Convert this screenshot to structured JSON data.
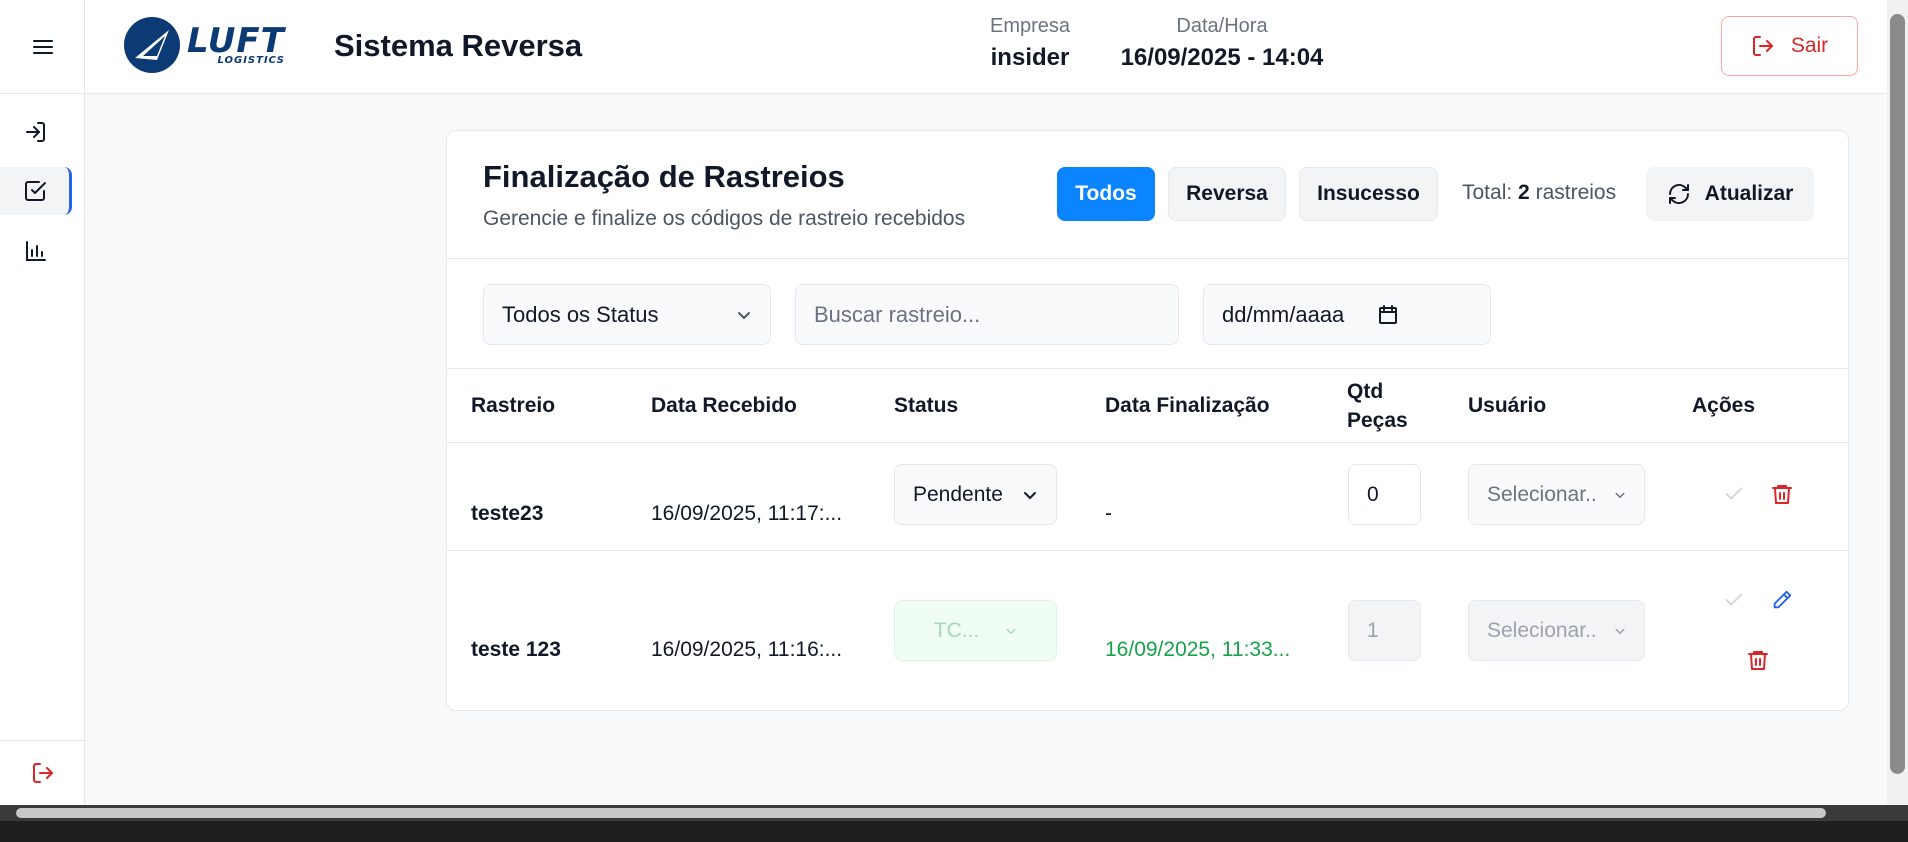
{
  "header": {
    "logo_text": "LUFT",
    "logo_sub": "LOGISTICS",
    "app_title": "Sistema Reversa",
    "empresa_label": "Empresa",
    "empresa_value": "insider",
    "datahora_label": "Data/Hora",
    "datahora_value": "16/09/2025 - 14:04",
    "logout_label": "Sair"
  },
  "sidebar": {
    "items": [
      {
        "icon": "login-icon"
      },
      {
        "icon": "check-square-icon",
        "active": true
      },
      {
        "icon": "bar-chart-icon"
      }
    ],
    "bottom_icon": "logout-icon"
  },
  "card": {
    "title": "Finalização de Rastreios",
    "subtitle": "Gerencie e finalize os códigos de rastreio recebidos",
    "filters_tabs": [
      "Todos",
      "Reversa",
      "Insucesso"
    ],
    "total_prefix": "Total:",
    "total_count": "2",
    "total_suffix": "rastreios",
    "refresh_label": "Atualizar"
  },
  "filters": {
    "status_selected": "Todos os Status",
    "search_placeholder": "Buscar rastreio...",
    "date_placeholder": "dd/mm/aaaa"
  },
  "table": {
    "columns": [
      "Rastreio",
      "Data Recebido",
      "Status",
      "Data Finalização",
      "Qtd",
      "Peças",
      "Usuário",
      "Ações"
    ],
    "rows": [
      {
        "rastreio": "teste23",
        "data_recebido": "16/09/2025, 11:17:...",
        "status": "Pendente",
        "data_finalizacao": "-",
        "qtd": "0",
        "usuario": "Selecionar.."
      },
      {
        "rastreio": "teste 123",
        "data_recebido": "16/09/2025, 11:16:...",
        "status": "TC...",
        "data_finalizacao": "16/09/2025, 11:33...",
        "qtd": "1",
        "usuario": "Selecionar.."
      }
    ]
  },
  "colors": {
    "primary": "#0a84ff",
    "danger": "#dc2626",
    "success": "#16a34a",
    "edit": "#2563eb",
    "brand": "#0b3a75"
  }
}
